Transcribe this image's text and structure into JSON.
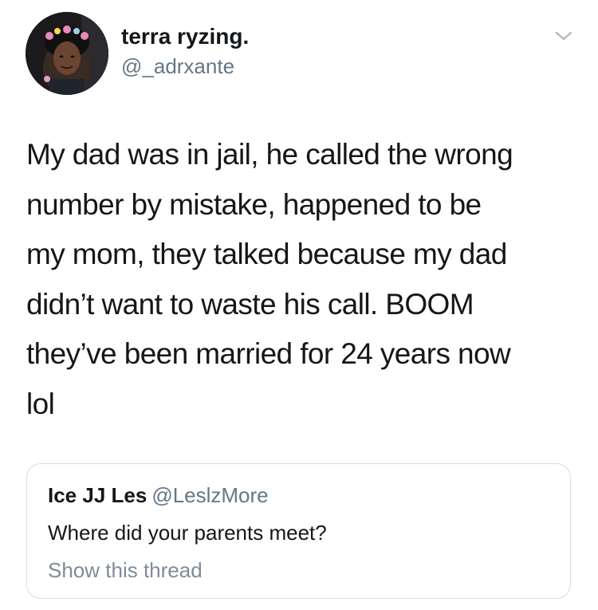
{
  "tweet": {
    "author": {
      "display_name": "terra ryzing.",
      "handle": "@_adrxante",
      "avatar_icon": "profile-photo"
    },
    "menu_icon": "chevron-down-icon",
    "text_lines": [
      "My dad was in jail, he called the wrong",
      "number by mistake, happened to be",
      "my mom, they talked because my dad",
      "didn’t want to waste his call. BOOM",
      "they’ve been married for 24 years now",
      "lol"
    ]
  },
  "quoted_tweet": {
    "display_name": "Ice JJ Les",
    "handle": "@LeslzMore",
    "text": "Where did your parents meet?",
    "show_thread_label": "Show this thread"
  },
  "colors": {
    "primary_text": "#14171a",
    "secondary_text": "#657786",
    "border": "#d5dde3"
  }
}
